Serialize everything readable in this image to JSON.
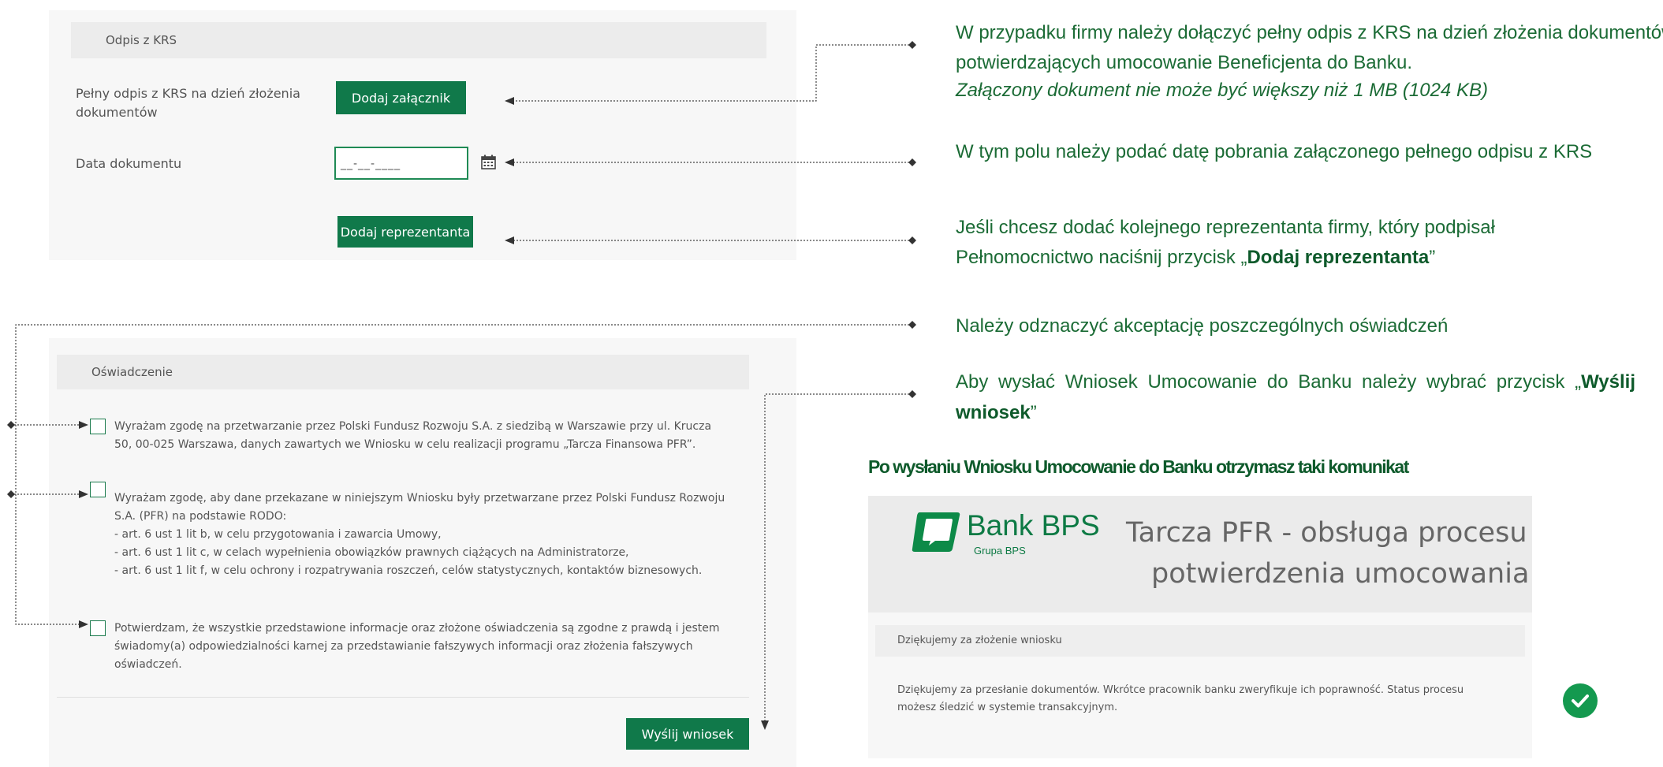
{
  "krs": {
    "section_title": "Odpis z KRS",
    "full_copy_label": "Pełny odpis z KRS na dzień złożenia dokumentów",
    "add_attachment_button": "Dodaj załącznik",
    "document_date_label": "Data dokumentu",
    "document_date_placeholder": "__-__-____",
    "add_representative_button": "Dodaj reprezentanta"
  },
  "declaration": {
    "section_title": "Oświadczenie",
    "statements": [
      "Wyrażam zgodę na przetwarzanie przez Polski Fundusz Rozwoju S.A. z siedzibą w Warszawie przy ul. Krucza 50, 00-025 Warszawa, danych zawartych we Wniosku w celu realizacji programu „Tarcza Finansowa PFR”.",
      "Wyrażam zgodę, aby dane przekazane w niniejszym Wniosku były przetwarzane przez Polski Fundusz Rozwoju S.A. (PFR) na podstawie RODO:",
      "Potwierdzam, że wszystkie przedstawione informacje oraz złożone oświadczenia są zgodne z prawdą i jestem świadomy(a) odpowiedzialności karnej za przedstawianie fałszywych informacji oraz złożenia fałszywych oświadczeń."
    ],
    "rodo_items": [
      "- art. 6 ust 1 lit b, w celu przygotowania i zawarcia Umowy,",
      "- art. 6 ust 1 lit c, w celach wypełnienia obowiązków prawnych ciążących na Administratorze,",
      "- art. 6 ust 1 lit f, w celu ochrony i rozpatrywania roszczeń, celów statystycznych, kontaktów biznesowych."
    ],
    "send_button": "Wyślij wniosek"
  },
  "notes": {
    "krs_line1": "W przypadku firmy należy dołączyć pełny odpis z KRS na dzień złożenia dokumentów",
    "krs_line2": "potwierdzających umocowanie Beneficjenta do Banku.",
    "krs_line3": "Załączony dokument nie może być większy niż 1 MB (1024 KB)",
    "date": "W tym polu należy podać datę pobrania załączonego pełnego odpisu z KRS",
    "rep_line1": "Jeśli chcesz dodać kolejnego reprezentanta firmy, który podpisał",
    "rep_line2_pre": "Pełnomocnictwo naciśnij przycisk „",
    "rep_line2_bold": "Dodaj reprezentanta",
    "rep_line2_post": "”",
    "accept": "Należy odznaczyć akceptację poszczególnych oświadczeń",
    "send_pre": "Aby wysłać Wniosek Umocowanie do Banku należy wybrać przycisk „",
    "send_bold1": "Wyślij",
    "send_bold2": "wniosek",
    "send_post": "”",
    "after_send": "Po wysłaniu Wniosku Umocowanie do Banku otrzymasz taki komunikat"
  },
  "confirmation": {
    "bank_name": "Bank BPS",
    "bank_group": "Grupa BPS",
    "app_title_line1": "Tarcza PFR - obsługa procesu",
    "app_title_line2": "potwierdzenia umocowania",
    "box_title": "Dziękujemy za złożenie wniosku",
    "message_line1": "Dziękujemy za przesłanie dokumentów. Wkrótce pracownik banku zweryfikuje ich poprawność. Status procesu",
    "message_line2": "możesz śledzić w systemie transakcyjnym."
  },
  "colors": {
    "brand_green": "#10794a",
    "note_green": "#1b6b35",
    "panel_bg": "#f7f7f7"
  }
}
